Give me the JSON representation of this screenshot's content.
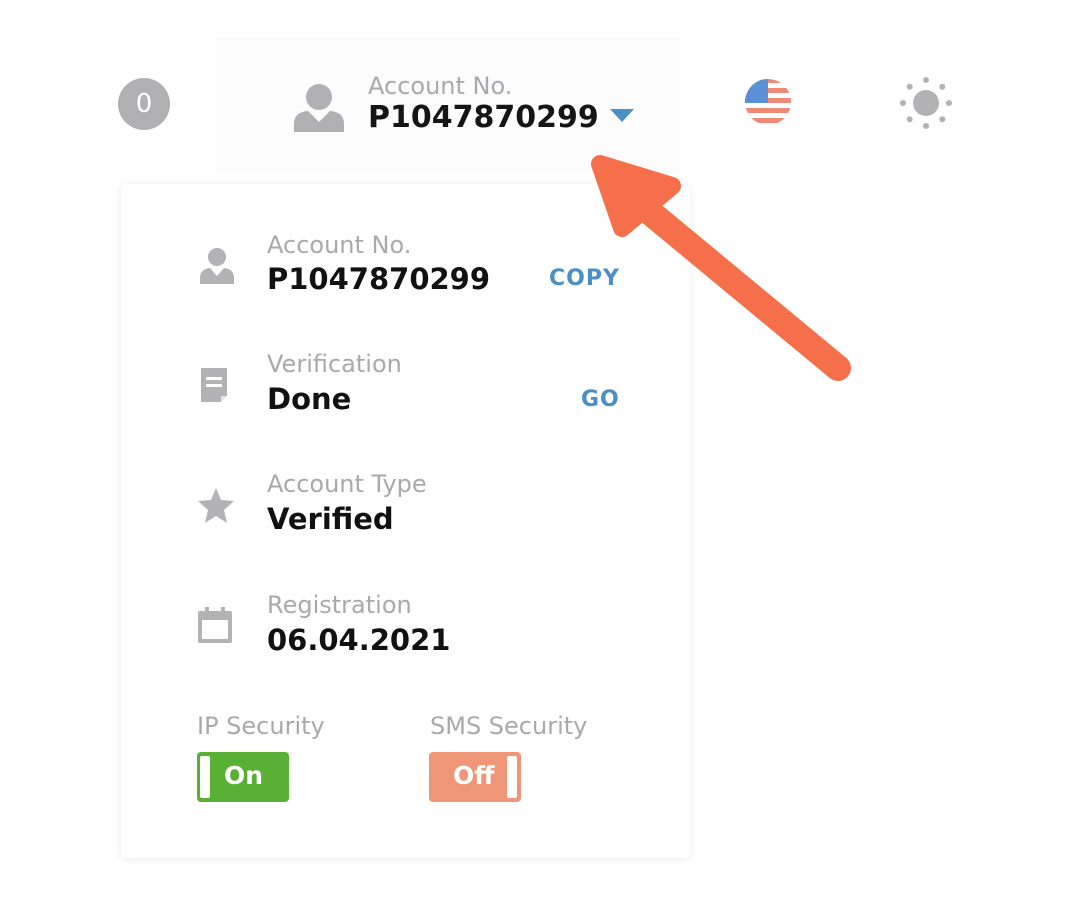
{
  "header": {
    "notification_count": "0",
    "account_label": "Account No.",
    "account_number": "P1047870299"
  },
  "dropdown": {
    "account": {
      "label": "Account No.",
      "value": "P1047870299",
      "action": "COPY"
    },
    "verification": {
      "label": "Verification",
      "value": "Done",
      "action": "GO"
    },
    "account_type": {
      "label": "Account Type",
      "value": "Verified"
    },
    "registration": {
      "label": "Registration",
      "value": "06.04.2021"
    },
    "ip_security": {
      "label": "IP Security",
      "state": "On"
    },
    "sms_security": {
      "label": "SMS Security",
      "state": "Off"
    }
  },
  "icons": {
    "notification": "notification-badge",
    "user": "user-icon",
    "caret": "caret-down-icon",
    "flag": "us-flag-icon",
    "theme": "sun-icon",
    "document": "document-icon",
    "star": "star-icon",
    "calendar": "calendar-icon",
    "annotation": "arrow-annotation"
  },
  "colors": {
    "accent_blue": "#4a90c7",
    "toggle_on": "#5ab034",
    "toggle_off": "#ee9677",
    "arrow": "#f5704a",
    "icon_gray": "#b3b3b6"
  }
}
